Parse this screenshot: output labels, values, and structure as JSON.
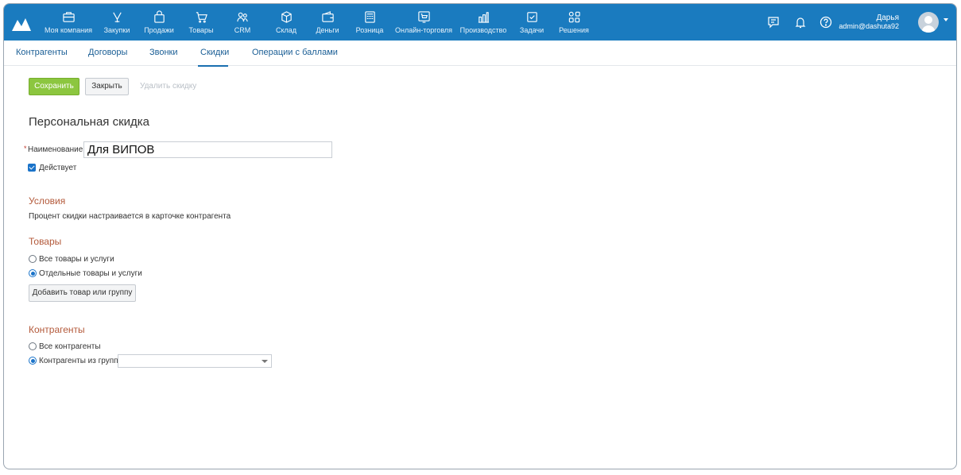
{
  "nav": {
    "items": [
      {
        "label": "Моя компания",
        "icon": "briefcase-icon"
      },
      {
        "label": "Закупки",
        "icon": "purchases-icon"
      },
      {
        "label": "Продажи",
        "icon": "bag-icon"
      },
      {
        "label": "Товары",
        "icon": "cart-icon"
      },
      {
        "label": "CRM",
        "icon": "people-icon"
      },
      {
        "label": "Склад",
        "icon": "box-icon"
      },
      {
        "label": "Деньги",
        "icon": "wallet-icon"
      },
      {
        "label": "Розница",
        "icon": "cash-register-icon"
      },
      {
        "label": "Онлайн-торговля",
        "icon": "online-store-icon"
      },
      {
        "label": "Производство",
        "icon": "production-icon"
      },
      {
        "label": "Задачи",
        "icon": "tasks-icon"
      },
      {
        "label": "Решения",
        "icon": "apps-icon"
      }
    ],
    "user_name": "Дарья",
    "user_email": "admin@dashuta92"
  },
  "subtabs": [
    "Контрагенты",
    "Договоры",
    "Звонки",
    "Скидки",
    "Операции с баллами"
  ],
  "active_subtab": "Скидки",
  "toolbar": {
    "save_label": "Сохранить",
    "close_label": "Закрыть",
    "delete_label": "Удалить скидку"
  },
  "form": {
    "title": "Персональная скидка",
    "required_mark": "*",
    "name_label": "Наименование",
    "name_value": "Для ВИПОВ",
    "active_label": "Действует",
    "active_checked": true,
    "conditions_heading": "Условия",
    "conditions_text": "Процент скидки настраивается в карточке контрагента",
    "goods_heading": "Товары",
    "goods_options": [
      "Все товары и услуги",
      "Отдельные товары и услуги"
    ],
    "goods_selected": 1,
    "add_goods_label": "Добавить товар или группу",
    "contractors_heading": "Контрагенты",
    "contractors_options": [
      "Все контрагенты",
      "Контрагенты из групп"
    ],
    "contractors_selected": 1,
    "groups_select_value": ""
  },
  "colors": {
    "topbar": "#1a7bbf",
    "save_button": "#8cc63f",
    "section_heading": "#b3593a",
    "link": "#1a5e95"
  }
}
